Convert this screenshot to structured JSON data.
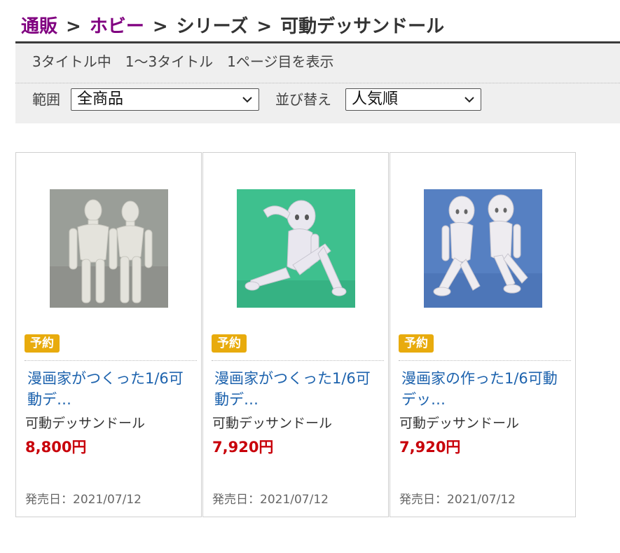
{
  "breadcrumb": {
    "items": [
      "通販",
      "ホビー",
      "シリーズ",
      "可動デッサンドール"
    ],
    "separator": ">"
  },
  "results": {
    "summary": "3タイトル中　1～3タイトル　1ページ目を表示"
  },
  "filters": {
    "scope_label": "範囲",
    "scope_value": "全商品",
    "sort_label": "並び替え",
    "sort_value": "人気順"
  },
  "products": [
    {
      "badge": "予約",
      "name": "漫画家がつくった1/6可動デ…",
      "series": "可動デッサンドール",
      "price": "8,800円",
      "release": "発売日：2021/07/12",
      "image": "male-and-female-gray-figures"
    },
    {
      "badge": "予約",
      "name": "漫画家がつくった1/6可動デ…",
      "series": "可動デッサンドール",
      "price": "7,920円",
      "release": "発売日：2021/07/12",
      "image": "seated-female-figure-green-background"
    },
    {
      "badge": "予約",
      "name": "漫画家の作った1/6可動デッ…",
      "series": "可動デッサンドール",
      "price": "7,920円",
      "release": "発売日：2021/07/12",
      "image": "two-seated-female-figures-blue-background"
    }
  ],
  "colors": {
    "breadcrumb_link": "#800080",
    "price": "#c8000a",
    "product_link": "#1c62ad",
    "badge": "#e8ab0d",
    "panel_background": "#efefef"
  }
}
